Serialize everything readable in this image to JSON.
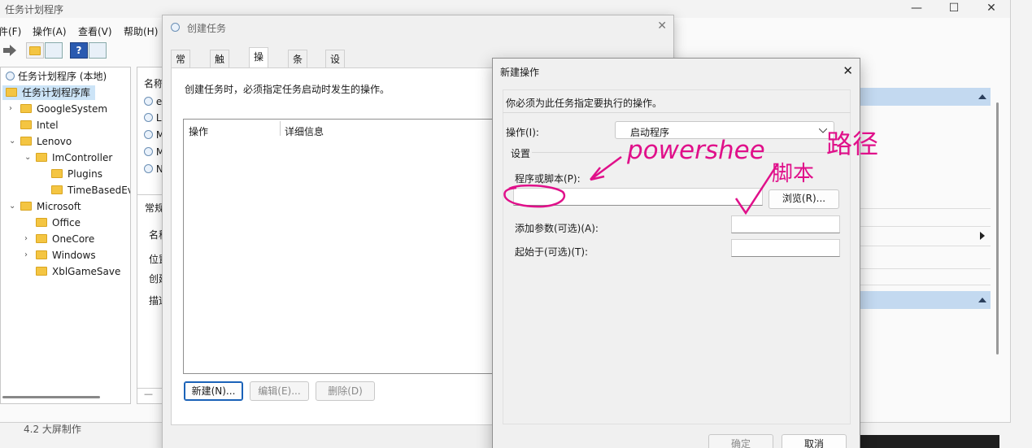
{
  "main_window": {
    "title": "任务计划程序",
    "controls": {
      "minimize": "—",
      "maximize": "☐",
      "close": "✕"
    },
    "menu": [
      "件(F)",
      "操作(A)",
      "查看(V)",
      "帮助(H)"
    ],
    "tree": [
      {
        "label": "任务计划程序 (本地)"
      },
      {
        "label": "任务计划程序库"
      },
      {
        "label": "GoogleSystem"
      },
      {
        "label": "Intel"
      },
      {
        "label": "Lenovo"
      },
      {
        "label": "ImController"
      },
      {
        "label": "Plugins"
      },
      {
        "label": "TimeBasedEv"
      },
      {
        "label": "Microsoft"
      },
      {
        "label": "Office"
      },
      {
        "label": "OneCore"
      },
      {
        "label": "Windows"
      },
      {
        "label": "XblGameSave"
      }
    ],
    "mid_column": {
      "header": "名称",
      "rows": [
        "e",
        "L",
        "M",
        "M",
        "N"
      ],
      "lower_header": "常规",
      "lower_labels": [
        "名称",
        "位置",
        "创建",
        "描述"
      ]
    }
  },
  "create_task": {
    "title": "创建任务",
    "tabs": [
      "常规",
      "触发器",
      "操作",
      "条件",
      "设置"
    ],
    "active_tab": "操作",
    "instruction": "创建任务时，必须指定任务启动时发生的操作。",
    "columns": [
      "操作",
      "详细信息"
    ],
    "buttons": {
      "new": "新建(N)...",
      "edit": "编辑(E)...",
      "delete": "删除(D)"
    }
  },
  "new_action": {
    "title": "新建操作",
    "instruction": "你必须为此任务指定要执行的操作。",
    "action_label": "操作(I):",
    "action_value": "启动程序",
    "settings_label": "设置",
    "program_label": "程序或脚本(P):",
    "program_value": "",
    "browse_button": "浏览(R)...",
    "args_label": "添加参数(可选)(A):",
    "args_value": "",
    "startin_label": "起始于(可选)(T):",
    "startin_value": "",
    "ok_button": "确定",
    "cancel_button": "取消"
  },
  "bottom_text": "4.2 大屏制作",
  "annotations": {
    "powershell_note": "powershee",
    "path_note": "路径",
    "script_note": "脚本",
    "color": "#e0108a"
  }
}
